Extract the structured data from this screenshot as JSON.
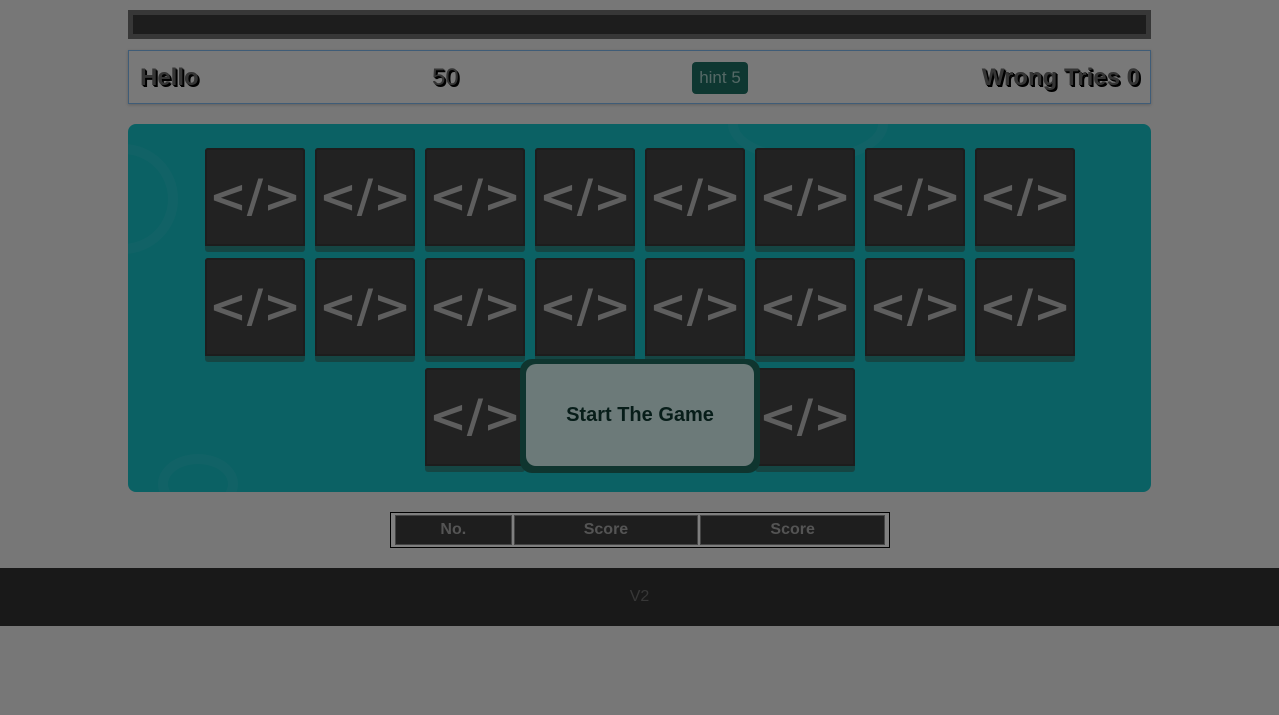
{
  "header": {
    "progress_percent": 100,
    "player_name": "Hello",
    "timer": "50",
    "hint_label": "hint 5",
    "wrong_tries": "Wrong Tries 0"
  },
  "board": {
    "card_symbol": "</>",
    "card_count": 20,
    "start_button": "Start The Game"
  },
  "score_table": {
    "headers": [
      "No.",
      "Score",
      "Score"
    ]
  },
  "footer": {
    "version": "V2"
  },
  "colors": {
    "board": "#16c2c9",
    "card": "#444444",
    "hint": "#1d6e63"
  }
}
